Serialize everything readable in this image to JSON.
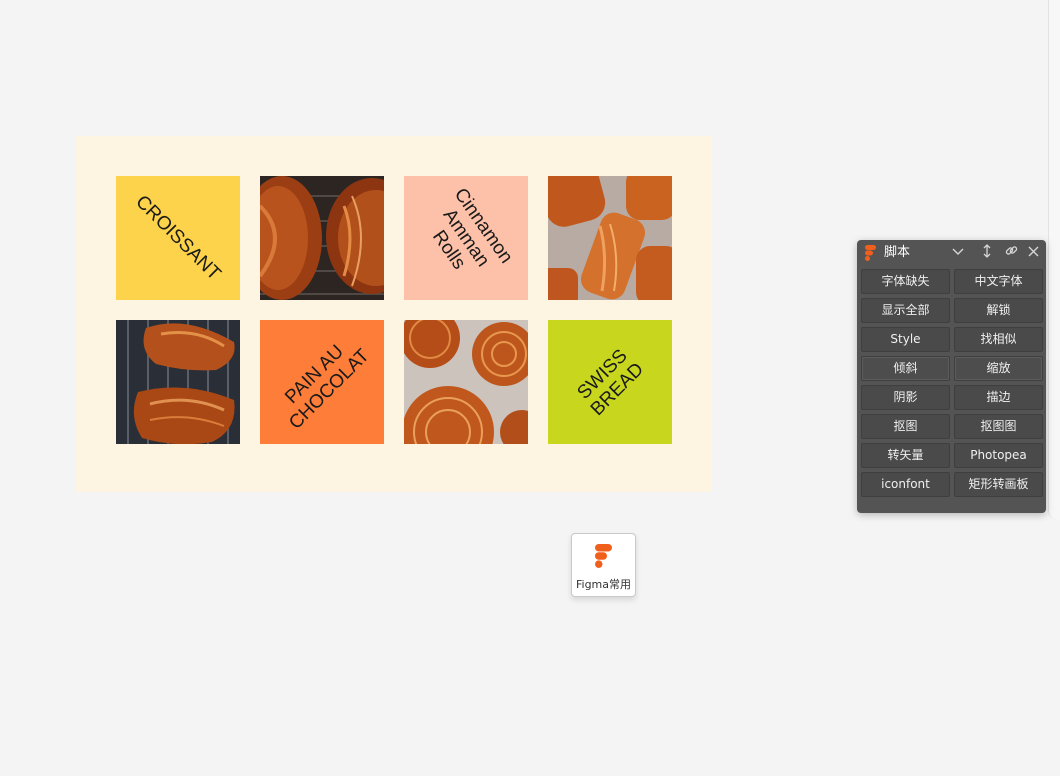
{
  "artboard": {
    "background": "#fdf5e1",
    "tiles": [
      {
        "kind": "text",
        "label": "CROISSANT",
        "color": "#fcd34a"
      },
      {
        "kind": "photo",
        "label": "pain au chocolat photo"
      },
      {
        "kind": "text",
        "label": "Cinnamon\nAmman Rolls",
        "color": "#fcc1a8"
      },
      {
        "kind": "photo",
        "label": "cinnamon rolls photo"
      },
      {
        "kind": "photo",
        "label": "croissant photo"
      },
      {
        "kind": "text",
        "label": "PAIN AU\nCHOCOLAT",
        "color": "#fd7d39"
      },
      {
        "kind": "photo",
        "label": "swiss bread photo"
      },
      {
        "kind": "text",
        "label": "SWISS BREAD",
        "color": "#c8d71e"
      }
    ]
  },
  "panel": {
    "title": "脚本",
    "header_icons": [
      "chevron-down-icon",
      "resize-vertical-icon",
      "link-icon",
      "close-icon"
    ],
    "buttons": [
      "字体缺失",
      "中文字体",
      "显示全部",
      "解锁",
      "Style",
      "找相似",
      "倾斜",
      "缩放",
      "阴影",
      "描边",
      "抠图",
      "抠图图",
      "转矢量",
      "Photopea",
      "iconfont",
      "矩形转画板"
    ]
  },
  "dock": {
    "label": "Figma常用",
    "icon": "figma-logo-icon"
  },
  "colors": {
    "figma_orange": "#f0601c",
    "panel_bg": "#545454"
  }
}
